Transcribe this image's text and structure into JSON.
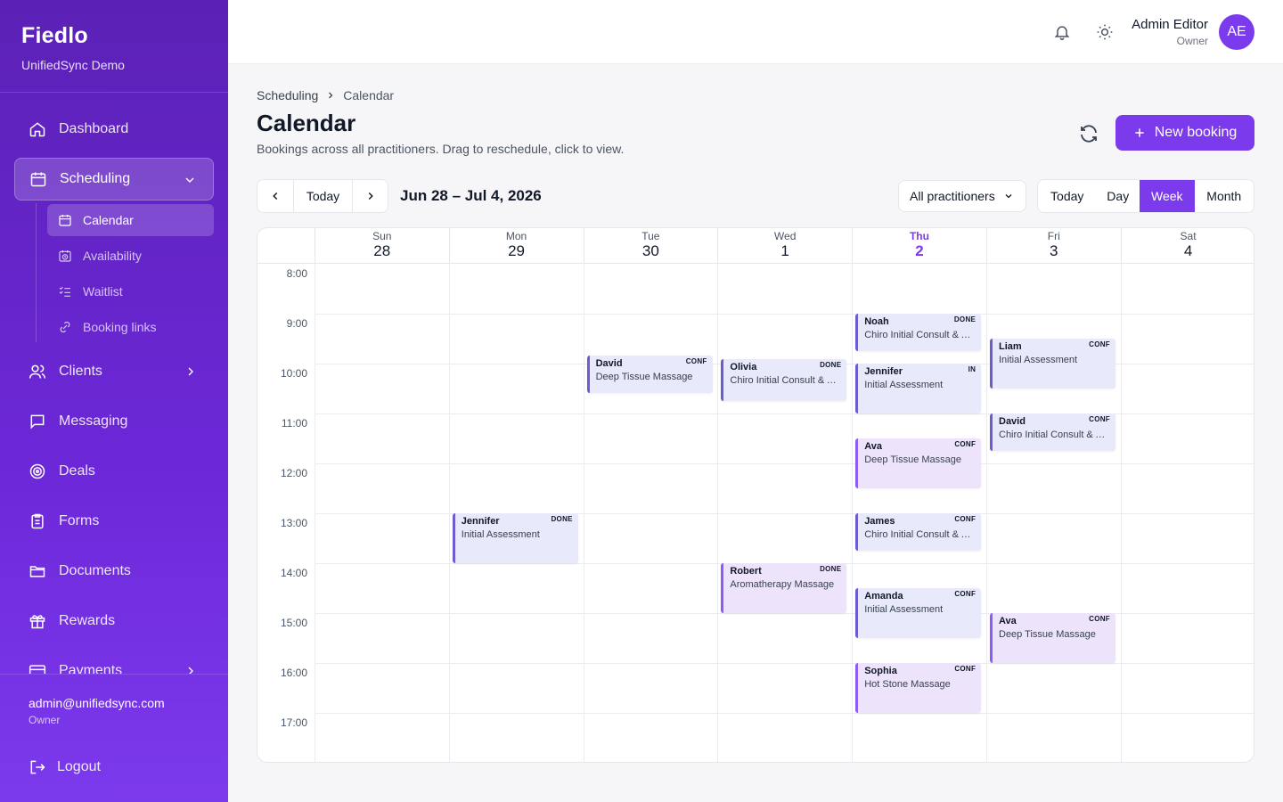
{
  "app": {
    "name": "Fiedlo",
    "subtitle": "UnifiedSync Demo"
  },
  "sidebar": {
    "items": [
      {
        "label": "Dashboard",
        "icon": "home-icon"
      },
      {
        "label": "Scheduling",
        "icon": "calendar-icon",
        "active": true,
        "expanded": true
      },
      {
        "label": "Clients",
        "icon": "users-icon"
      },
      {
        "label": "Messaging",
        "icon": "message-icon"
      },
      {
        "label": "Deals",
        "icon": "target-icon"
      },
      {
        "label": "Forms",
        "icon": "clipboard-icon"
      },
      {
        "label": "Documents",
        "icon": "folder-icon"
      },
      {
        "label": "Rewards",
        "icon": "gift-icon"
      },
      {
        "label": "Payments",
        "icon": "card-icon"
      }
    ],
    "subitems": [
      {
        "label": "Calendar",
        "icon": "calendar-icon",
        "active": true
      },
      {
        "label": "Availability",
        "icon": "calendar-clock-icon"
      },
      {
        "label": "Waitlist",
        "icon": "list-check-icon"
      },
      {
        "label": "Booking links",
        "icon": "link-icon"
      }
    ],
    "footer": {
      "email": "admin@unifiedsync.com",
      "role": "Owner",
      "logout": "Logout"
    }
  },
  "topbar": {
    "user_name": "Admin Editor",
    "user_role": "Owner",
    "avatar_initials": "AE"
  },
  "page": {
    "breadcrumb": [
      "Scheduling",
      "Calendar"
    ],
    "title": "Calendar",
    "subtitle": "Bookings across all practitioners. Drag to reschedule, click to view.",
    "new_booking": "New booking"
  },
  "toolbar": {
    "today": "Today",
    "date_range": "Jun 28 – Jul 4, 2026",
    "practitioner_filter": "All practitioners",
    "views": [
      "Today",
      "Day",
      "Week",
      "Month"
    ],
    "active_view": "Week"
  },
  "calendar": {
    "days": [
      {
        "name": "Sun",
        "date": "28"
      },
      {
        "name": "Mon",
        "date": "29"
      },
      {
        "name": "Tue",
        "date": "30"
      },
      {
        "name": "Wed",
        "date": "1"
      },
      {
        "name": "Thu",
        "date": "2",
        "today": true
      },
      {
        "name": "Fri",
        "date": "3"
      },
      {
        "name": "Sat",
        "date": "4"
      }
    ],
    "hours": [
      "8:00",
      "9:00",
      "10:00",
      "11:00",
      "12:00",
      "13:00",
      "14:00",
      "15:00",
      "16:00",
      "17:00"
    ],
    "colors": {
      "blue_event": "#e8e9fb",
      "purple_event": "#ede4fb",
      "accent": "#7c3aed"
    },
    "events": [
      {
        "day": 2,
        "start": "9:50",
        "end": "10:35",
        "name": "David",
        "service": "Deep Tissue Massage",
        "status": "CONF",
        "tone": "blue"
      },
      {
        "day": 3,
        "start": "9:55",
        "end": "10:45",
        "name": "Olivia",
        "service": "Chiro Initial Consult & Adjustment",
        "status": "DONE",
        "tone": "blue"
      },
      {
        "day": 4,
        "start": "9:00",
        "end": "9:45",
        "name": "Noah",
        "service": "Chiro Initial Consult & Adjustment",
        "status": "DONE",
        "tone": "blue"
      },
      {
        "day": 4,
        "start": "10:00",
        "end": "11:00",
        "name": "Jennifer",
        "service": "Initial Assessment",
        "status": "IN",
        "tone": "blue"
      },
      {
        "day": 4,
        "start": "11:30",
        "end": "12:30",
        "name": "Ava",
        "service": "Deep Tissue Massage",
        "status": "CONF",
        "tone": "purple"
      },
      {
        "day": 4,
        "start": "13:00",
        "end": "13:45",
        "name": "James",
        "service": "Chiro Initial Consult & Adjustment",
        "status": "CONF",
        "tone": "blue"
      },
      {
        "day": 4,
        "start": "14:30",
        "end": "15:30",
        "name": "Amanda",
        "service": "Initial Assessment",
        "status": "CONF",
        "tone": "blue"
      },
      {
        "day": 4,
        "start": "16:00",
        "end": "17:00",
        "name": "Sophia",
        "service": "Hot Stone Massage",
        "status": "CONF",
        "tone": "purple"
      },
      {
        "day": 5,
        "start": "9:30",
        "end": "10:30",
        "name": "Liam",
        "service": "Initial Assessment",
        "status": "CONF",
        "tone": "blue"
      },
      {
        "day": 5,
        "start": "11:00",
        "end": "11:45",
        "name": "David",
        "service": "Chiro Initial Consult & Adjustment",
        "status": "CONF",
        "tone": "blue"
      },
      {
        "day": 5,
        "start": "15:00",
        "end": "16:00",
        "name": "Ava",
        "service": "Deep Tissue Massage",
        "status": "CONF",
        "tone": "purple"
      },
      {
        "day": 1,
        "start": "13:00",
        "end": "14:00",
        "name": "Jennifer",
        "service": "Initial Assessment",
        "status": "DONE",
        "tone": "blue"
      },
      {
        "day": 3,
        "start": "14:00",
        "end": "15:00",
        "name": "Robert",
        "service": "Aromatherapy Massage",
        "status": "DONE",
        "tone": "purple"
      }
    ]
  }
}
